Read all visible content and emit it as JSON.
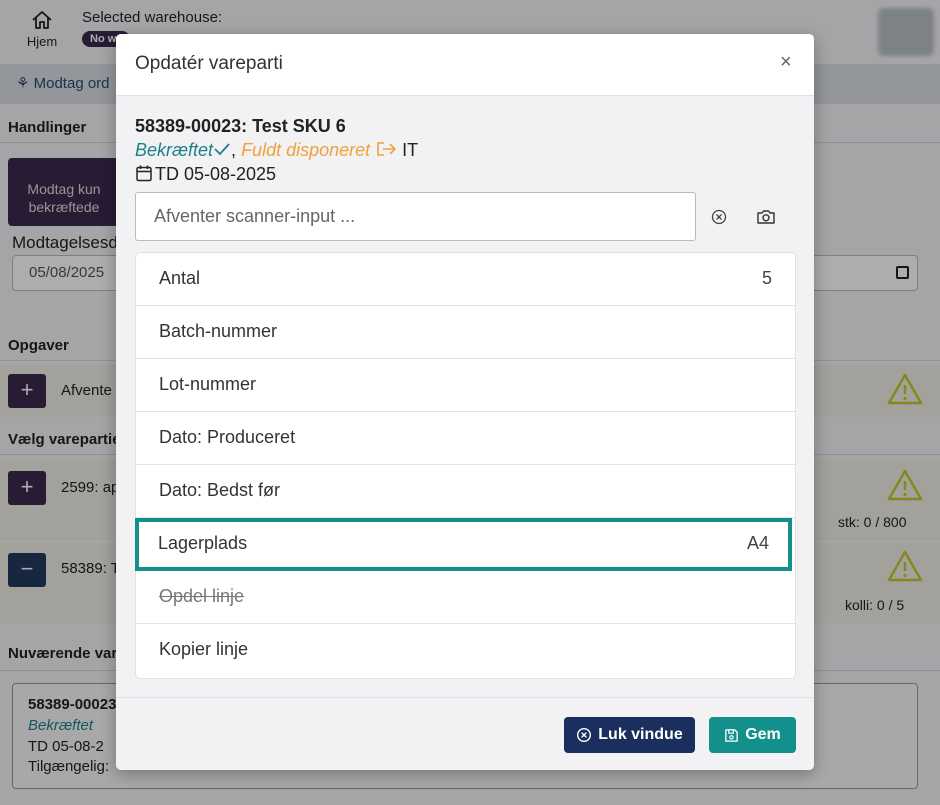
{
  "header": {
    "home_label": "Hjem",
    "selected_warehouse_label": "Selected warehouse:",
    "warehouse_badge": "No wa"
  },
  "nav": {
    "receive_orders": "Modtag ord"
  },
  "background": {
    "actions_heading": "Handlinger",
    "receive_button": "Modtag kun bekræftede",
    "receive_button_line1": "Modtag kun",
    "receive_button_line2": "bekræftede",
    "receipt_date_label": "Modtagelsesd",
    "receipt_date_value": "05/08/2025",
    "tasks_heading": "Opgaver",
    "task_1": "Afvente",
    "choose_lots_heading": "Vælg varepartie",
    "lot_row_1": "2599: ap",
    "lot_row_1_qty": "stk: 0 / 800",
    "lot_row_2": "58389: T",
    "lot_row_2_qty": "kolli: 0 / 5",
    "current_heading": "Nuværende var",
    "current_card": {
      "title": "58389-00023",
      "status": "Bekræftet",
      "date": "TD 05-08-2",
      "available": "Tilgængelig: "
    }
  },
  "modal": {
    "title": "Opdatér vareparti",
    "close_symbol": "×",
    "lot_title": "58389-00023: Test SKU 6",
    "status_confirmed": "Bekræftet",
    "status_separator": ",",
    "status_disposed": "Fuldt disponeret",
    "status_location": "IT",
    "date_text": "TD 05-08-2025",
    "scanner_placeholder": "Afventer scanner-input ...",
    "rows": [
      {
        "label": "Antal",
        "value": "5"
      },
      {
        "label": "Batch-nummer",
        "value": ""
      },
      {
        "label": "Lot-nummer",
        "value": ""
      },
      {
        "label": "Dato: Produceret",
        "value": ""
      },
      {
        "label": "Dato: Bedst før",
        "value": ""
      },
      {
        "label": "Lagerplads",
        "value": "A4"
      },
      {
        "label": "Opdel linje",
        "value": ""
      },
      {
        "label": "Kopier linje",
        "value": ""
      }
    ],
    "close_button": "Luk vindue",
    "save_button": "Gem"
  },
  "colors": {
    "accent_teal": "#14908c",
    "navy": "#1b2f5e",
    "purple": "#3b2a4e",
    "warning_yellow": "#c8c832",
    "disposed_orange": "#f0a03c"
  }
}
